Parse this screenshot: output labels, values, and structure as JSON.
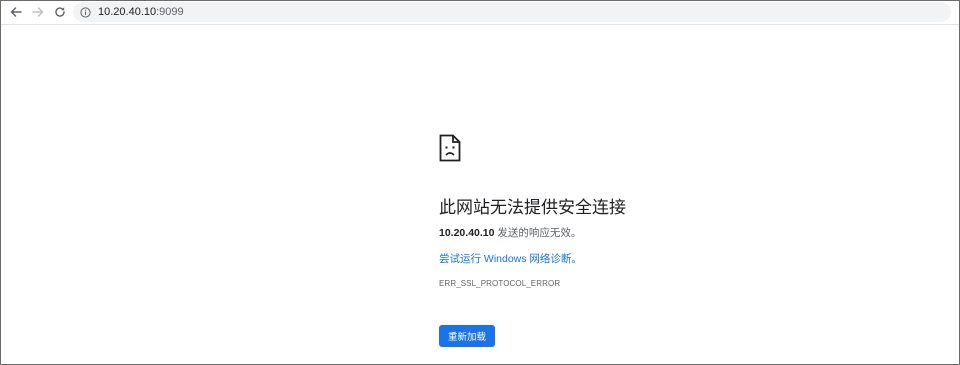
{
  "toolbar": {
    "back_icon": "back-arrow-icon",
    "forward_icon": "forward-arrow-icon",
    "reload_icon": "reload-icon",
    "site_info_icon": "info-icon",
    "url_host": "10.20.40.10",
    "url_port": ":9099"
  },
  "error": {
    "icon": "sad-document-icon",
    "heading": "此网站无法提供安全连接",
    "host": "10.20.40.10",
    "message_suffix": " 发送的响应无效。",
    "suggestion": "尝试运行 Windows 网络诊断。",
    "code": "ERR_SSL_PROTOCOL_ERROR",
    "reload_label": "重新加载"
  },
  "colors": {
    "accent": "#1a73e8",
    "heading_text": "#202124",
    "secondary_text": "#5f6368",
    "omnibox_bg": "#f1f3f4"
  }
}
